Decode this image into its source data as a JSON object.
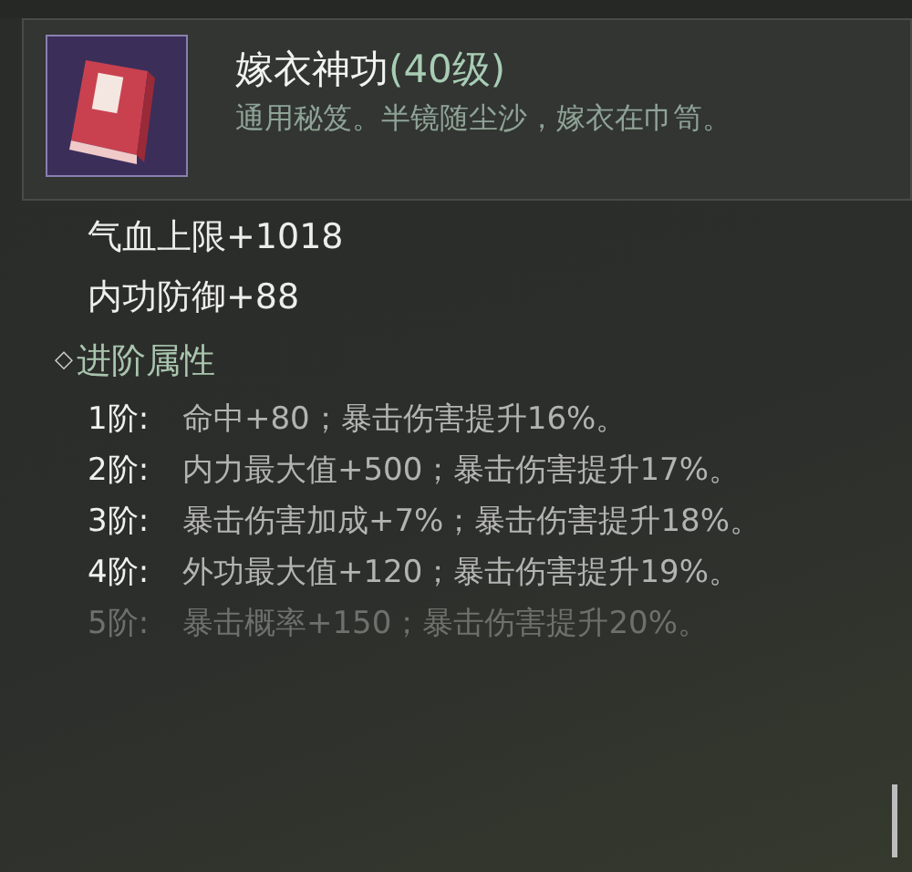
{
  "item": {
    "name": "嫁衣神功",
    "level": "(40级)",
    "description": "通用秘笈。半镜随尘沙，嫁衣在巾笥。"
  },
  "stats": [
    "气血上限+1018",
    "内功防御+88"
  ],
  "advanced": {
    "marker": "◇",
    "title": "进阶属性",
    "tiers": [
      {
        "label": "1阶:",
        "text": "命中+80；暴击伤害提升16%。",
        "unlocked": true
      },
      {
        "label": "2阶:",
        "text": "内力最大值+500；暴击伤害提升17%。",
        "unlocked": true
      },
      {
        "label": "3阶:",
        "text": "暴击伤害加成+7%；暴击伤害提升18%。",
        "unlocked": true
      },
      {
        "label": "4阶:",
        "text": "外功最大值+120；暴击伤害提升19%。",
        "unlocked": true
      },
      {
        "label": "5阶:",
        "text": "暴击概率+150；暴击伤害提升20%。",
        "unlocked": false
      }
    ]
  }
}
